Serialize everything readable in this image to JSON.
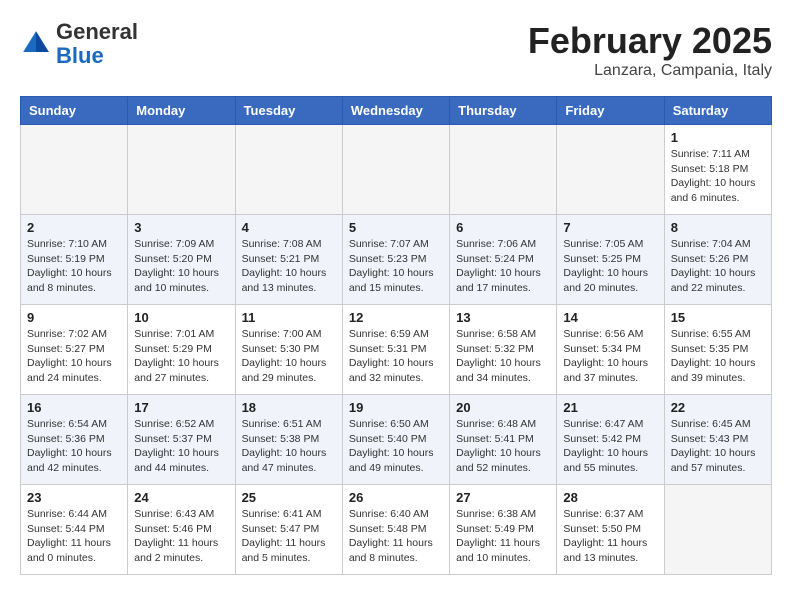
{
  "header": {
    "logo_general": "General",
    "logo_blue": "Blue",
    "month": "February 2025",
    "location": "Lanzara, Campania, Italy"
  },
  "weekdays": [
    "Sunday",
    "Monday",
    "Tuesday",
    "Wednesday",
    "Thursday",
    "Friday",
    "Saturday"
  ],
  "weeks": [
    [
      {
        "day": "",
        "info": ""
      },
      {
        "day": "",
        "info": ""
      },
      {
        "day": "",
        "info": ""
      },
      {
        "day": "",
        "info": ""
      },
      {
        "day": "",
        "info": ""
      },
      {
        "day": "",
        "info": ""
      },
      {
        "day": "1",
        "info": "Sunrise: 7:11 AM\nSunset: 5:18 PM\nDaylight: 10 hours\nand 6 minutes."
      }
    ],
    [
      {
        "day": "2",
        "info": "Sunrise: 7:10 AM\nSunset: 5:19 PM\nDaylight: 10 hours\nand 8 minutes."
      },
      {
        "day": "3",
        "info": "Sunrise: 7:09 AM\nSunset: 5:20 PM\nDaylight: 10 hours\nand 10 minutes."
      },
      {
        "day": "4",
        "info": "Sunrise: 7:08 AM\nSunset: 5:21 PM\nDaylight: 10 hours\nand 13 minutes."
      },
      {
        "day": "5",
        "info": "Sunrise: 7:07 AM\nSunset: 5:23 PM\nDaylight: 10 hours\nand 15 minutes."
      },
      {
        "day": "6",
        "info": "Sunrise: 7:06 AM\nSunset: 5:24 PM\nDaylight: 10 hours\nand 17 minutes."
      },
      {
        "day": "7",
        "info": "Sunrise: 7:05 AM\nSunset: 5:25 PM\nDaylight: 10 hours\nand 20 minutes."
      },
      {
        "day": "8",
        "info": "Sunrise: 7:04 AM\nSunset: 5:26 PM\nDaylight: 10 hours\nand 22 minutes."
      }
    ],
    [
      {
        "day": "9",
        "info": "Sunrise: 7:02 AM\nSunset: 5:27 PM\nDaylight: 10 hours\nand 24 minutes."
      },
      {
        "day": "10",
        "info": "Sunrise: 7:01 AM\nSunset: 5:29 PM\nDaylight: 10 hours\nand 27 minutes."
      },
      {
        "day": "11",
        "info": "Sunrise: 7:00 AM\nSunset: 5:30 PM\nDaylight: 10 hours\nand 29 minutes."
      },
      {
        "day": "12",
        "info": "Sunrise: 6:59 AM\nSunset: 5:31 PM\nDaylight: 10 hours\nand 32 minutes."
      },
      {
        "day": "13",
        "info": "Sunrise: 6:58 AM\nSunset: 5:32 PM\nDaylight: 10 hours\nand 34 minutes."
      },
      {
        "day": "14",
        "info": "Sunrise: 6:56 AM\nSunset: 5:34 PM\nDaylight: 10 hours\nand 37 minutes."
      },
      {
        "day": "15",
        "info": "Sunrise: 6:55 AM\nSunset: 5:35 PM\nDaylight: 10 hours\nand 39 minutes."
      }
    ],
    [
      {
        "day": "16",
        "info": "Sunrise: 6:54 AM\nSunset: 5:36 PM\nDaylight: 10 hours\nand 42 minutes."
      },
      {
        "day": "17",
        "info": "Sunrise: 6:52 AM\nSunset: 5:37 PM\nDaylight: 10 hours\nand 44 minutes."
      },
      {
        "day": "18",
        "info": "Sunrise: 6:51 AM\nSunset: 5:38 PM\nDaylight: 10 hours\nand 47 minutes."
      },
      {
        "day": "19",
        "info": "Sunrise: 6:50 AM\nSunset: 5:40 PM\nDaylight: 10 hours\nand 49 minutes."
      },
      {
        "day": "20",
        "info": "Sunrise: 6:48 AM\nSunset: 5:41 PM\nDaylight: 10 hours\nand 52 minutes."
      },
      {
        "day": "21",
        "info": "Sunrise: 6:47 AM\nSunset: 5:42 PM\nDaylight: 10 hours\nand 55 minutes."
      },
      {
        "day": "22",
        "info": "Sunrise: 6:45 AM\nSunset: 5:43 PM\nDaylight: 10 hours\nand 57 minutes."
      }
    ],
    [
      {
        "day": "23",
        "info": "Sunrise: 6:44 AM\nSunset: 5:44 PM\nDaylight: 11 hours\nand 0 minutes."
      },
      {
        "day": "24",
        "info": "Sunrise: 6:43 AM\nSunset: 5:46 PM\nDaylight: 11 hours\nand 2 minutes."
      },
      {
        "day": "25",
        "info": "Sunrise: 6:41 AM\nSunset: 5:47 PM\nDaylight: 11 hours\nand 5 minutes."
      },
      {
        "day": "26",
        "info": "Sunrise: 6:40 AM\nSunset: 5:48 PM\nDaylight: 11 hours\nand 8 minutes."
      },
      {
        "day": "27",
        "info": "Sunrise: 6:38 AM\nSunset: 5:49 PM\nDaylight: 11 hours\nand 10 minutes."
      },
      {
        "day": "28",
        "info": "Sunrise: 6:37 AM\nSunset: 5:50 PM\nDaylight: 11 hours\nand 13 minutes."
      },
      {
        "day": "",
        "info": ""
      }
    ]
  ]
}
